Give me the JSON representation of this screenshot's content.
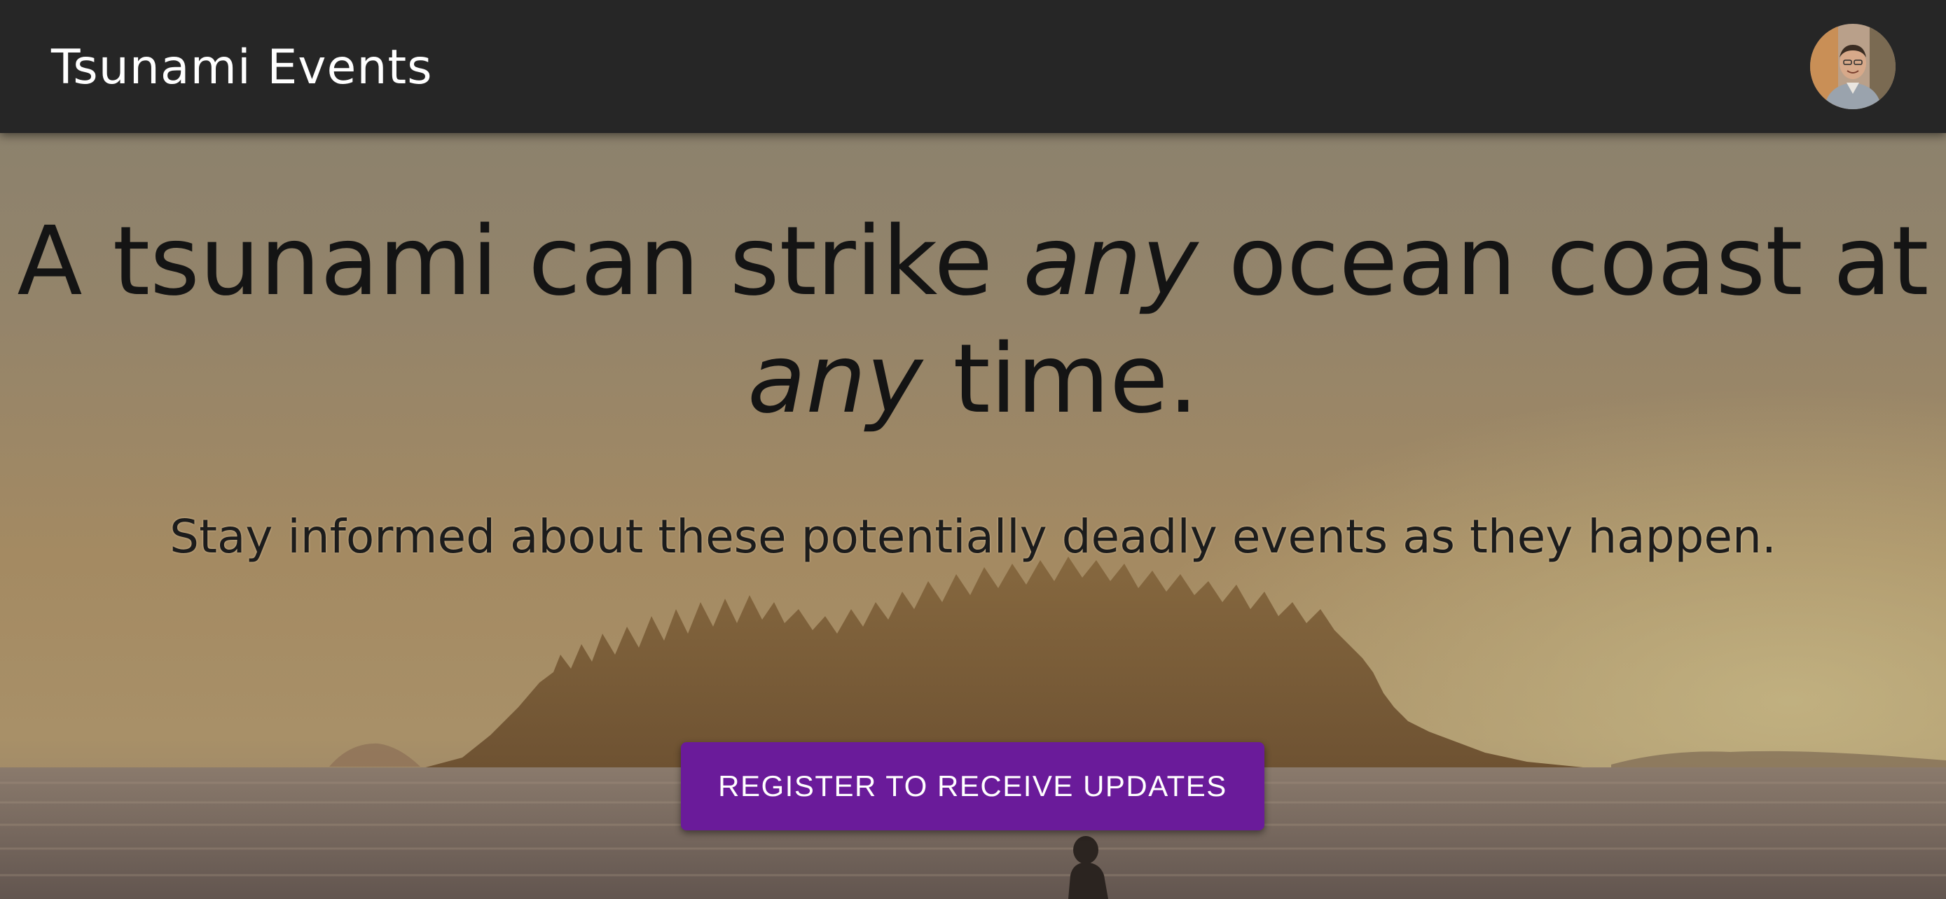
{
  "header": {
    "title": "Tsunami Events",
    "avatar_alt": "User avatar"
  },
  "hero": {
    "headline_part1": "A tsunami can strike ",
    "headline_em1": "any",
    "headline_part2": " ocean coast at ",
    "headline_em2": "any",
    "headline_part3": " time.",
    "subheadline": "Stay informed about these potentially deadly events as they happen.",
    "cta_label": "REGISTER TO RECEIVE UPDATES"
  },
  "colors": {
    "toolbar": "#262626",
    "cta": "#6a1b9a",
    "headline_text": "#141414"
  },
  "icons": {
    "avatar": "user-photo"
  }
}
